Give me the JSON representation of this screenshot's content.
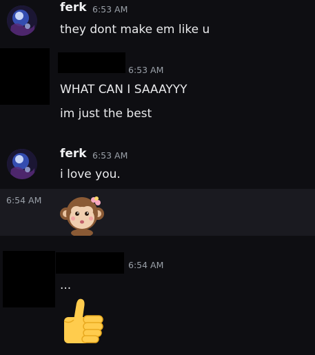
{
  "messages": [
    {
      "author": "ferk",
      "time": "6:53 AM",
      "lines": [
        "they dont make em like u"
      ]
    },
    {
      "author": "",
      "time": "6:53 AM",
      "lines": [
        "WHAT CAN I SAAAYYY",
        "im just the best"
      ]
    },
    {
      "author": "ferk",
      "time": "6:53 AM",
      "lines": [
        "i love you."
      ]
    },
    {
      "continuation_time": "6:54 AM",
      "sticker": "monkey-sticker"
    },
    {
      "author": "",
      "time": "6:54 AM",
      "lines": [
        "..."
      ],
      "emoji": "thumbs-up-emoji"
    }
  ],
  "colors": {
    "background": "#0e0e12",
    "hover_row": "#1a1a20",
    "username": "#f2f3f5",
    "timestamp": "#9aa0a8",
    "message_text": "#e9eaec",
    "redaction": "#000000"
  },
  "icons": [
    "avatar-ferk",
    "monkey-sticker",
    "thumbs-up-emoji"
  ]
}
